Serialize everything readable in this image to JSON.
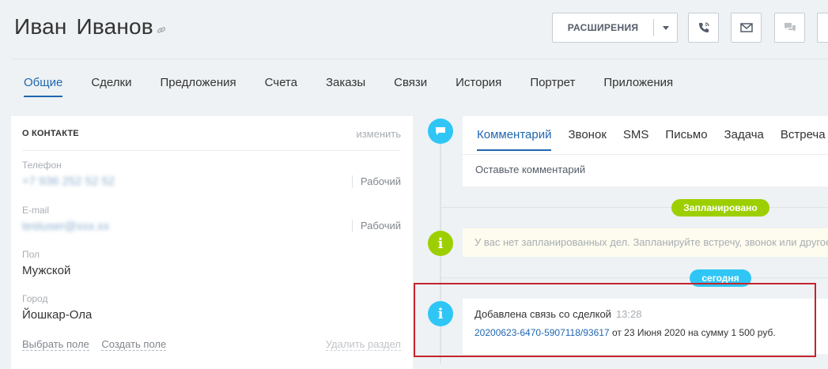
{
  "header": {
    "title": "Иван  Иванов",
    "extensions_label": "РАСШИРЕНИЯ"
  },
  "tabs": [
    "Общие",
    "Сделки",
    "Предложения",
    "Счета",
    "Заказы",
    "Связи",
    "История",
    "Портрет",
    "Приложения"
  ],
  "contact_card": {
    "title": "О КОНТАКТЕ",
    "edit": "изменить",
    "fields": {
      "phone_label": "Телефон",
      "phone_value": "+7 936 252 52 52",
      "phone_type": "Рабочий",
      "email_label": "E-mail",
      "email_value": "testuser@xxx.xx",
      "email_type": "Рабочий",
      "gender_label": "Пол",
      "gender_value": "Мужской",
      "city_label": "Город",
      "city_value": "Йошкар-Ола"
    },
    "footer": {
      "choose_field": "Выбрать поле",
      "create_field": "Создать поле",
      "delete_section": "Удалить раздел"
    }
  },
  "timeline": {
    "editor_tabs": [
      "Комментарий",
      "Звонок",
      "SMS",
      "Письмо",
      "Задача",
      "Встреча"
    ],
    "comment_placeholder": "Оставьте комментарий",
    "planned_badge": "Запланировано",
    "planned_notice": "У вас нет запланированных дел. Запланируйте встречу, звонок или другое",
    "today_badge": "сегодня",
    "event": {
      "title": "Добавлена связь со сделкой",
      "time": "13:28",
      "deal_link": "20200623-6470-5907118/93617",
      "details": " от 23 Июня 2020 на сумму 1 500 руб."
    }
  },
  "colors": {
    "accent_blue": "#2067b0",
    "timeline_blue": "#2fc6f6",
    "timeline_green": "#9dcf00",
    "highlight_red": "#c4232d"
  },
  "icons": [
    "link-icon",
    "chevron-down-icon",
    "phone-icon",
    "mail-icon",
    "chat-icon",
    "comment-icon",
    "info-icon"
  ]
}
